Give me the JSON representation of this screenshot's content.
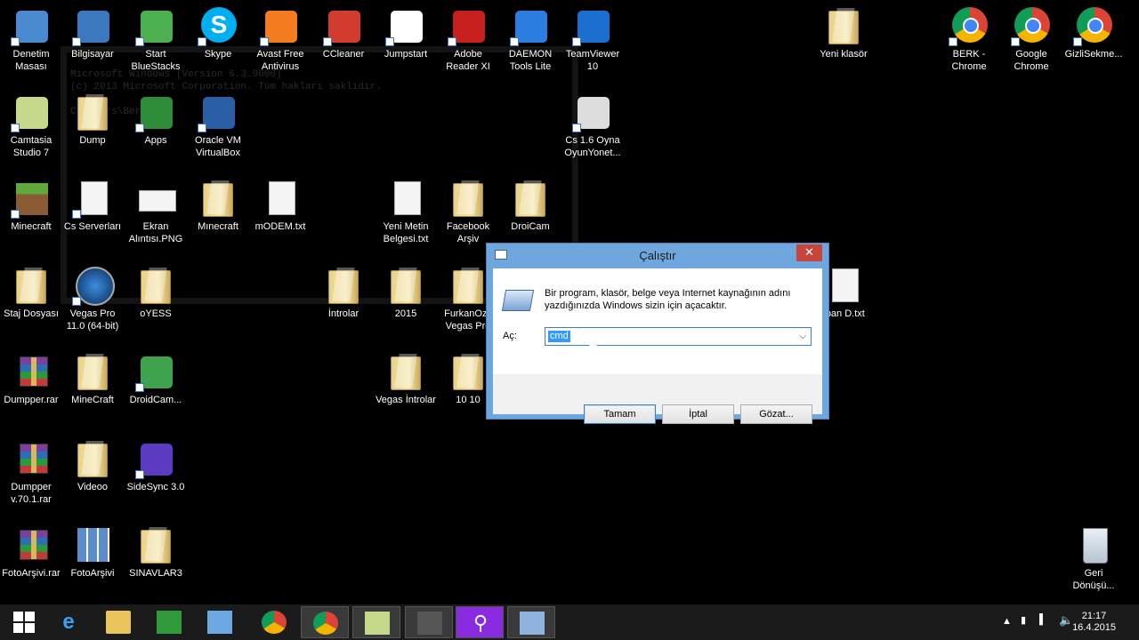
{
  "console": {
    "line1": "Microsoft Windows [Version 6.3.9600]",
    "line2": "(c) 2013 Microsoft Corporation. Tüm hakları saklıdır.",
    "line3": "C:\\Users\\Berk>"
  },
  "desktop_icons": [
    {
      "label": "Denetim Masası",
      "icon": "control-panel-icon"
    },
    {
      "label": "Bilgisayar",
      "icon": "computer-icon"
    },
    {
      "label": "Start BlueStacks",
      "icon": "bluestacks-icon"
    },
    {
      "label": "Skype",
      "icon": "skype-icon"
    },
    {
      "label": "Avast Free Antivirus",
      "icon": "avast-icon"
    },
    {
      "label": "CCleaner",
      "icon": "ccleaner-icon"
    },
    {
      "label": "Jumpstart",
      "icon": "jumpstart-icon"
    },
    {
      "label": "Adobe Reader XI",
      "icon": "adobe-reader-icon"
    },
    {
      "label": "DAEMON Tools Lite",
      "icon": "daemon-tools-icon"
    },
    {
      "label": "TeamViewer 10",
      "icon": "teamviewer-icon"
    },
    {
      "label": "Yeni klasör",
      "icon": "folder-icon"
    },
    {
      "label": "BERK - Chrome",
      "icon": "chrome-icon"
    },
    {
      "label": "Google Chrome",
      "icon": "chrome-icon"
    },
    {
      "label": "GizliSekme...",
      "icon": "chrome-icon"
    },
    {
      "label": "Camtasia Studio 7",
      "icon": "camtasia-icon"
    },
    {
      "label": "Dump",
      "icon": "folder-icon"
    },
    {
      "label": "Apps",
      "icon": "apps-icon"
    },
    {
      "label": "Oracle VM VirtualBox",
      "icon": "virtualbox-icon"
    },
    {
      "label": "Cs 1.6 Oyna OyunYonet...",
      "icon": "counter-strike-icon"
    },
    {
      "label": "Minecraft",
      "icon": "minecraft-icon"
    },
    {
      "label": "Cs Serverları",
      "icon": "document-icon"
    },
    {
      "label": "Ekran Alıntısı.PNG",
      "icon": "image-icon"
    },
    {
      "label": "Mınecraft",
      "icon": "folder-icon"
    },
    {
      "label": "mODEM.txt",
      "icon": "text-file-icon"
    },
    {
      "label": "Yeni Metin Belgesi.txt",
      "icon": "text-file-icon"
    },
    {
      "label": "Facebook Arşiv",
      "icon": "folder-icon"
    },
    {
      "label": "DroiCam",
      "icon": "folder-icon"
    },
    {
      "label": "Staj Dosyası",
      "icon": "folder-icon"
    },
    {
      "label": "Vegas Pro 11.0 (64-bit)",
      "icon": "vegas-pro-icon"
    },
    {
      "label": "oYESS",
      "icon": "folder-icon"
    },
    {
      "label": "İntrolar",
      "icon": "folder-icon"
    },
    {
      "label": "2015",
      "icon": "folder-icon"
    },
    {
      "label": "FurkanOzk Vegas Pro",
      "icon": "folder-icon"
    },
    {
      "label": "rban D.txt",
      "icon": "text-file-icon"
    },
    {
      "label": "Dumpper.rar",
      "icon": "winrar-icon"
    },
    {
      "label": "MineCraft",
      "icon": "folder-icon"
    },
    {
      "label": "DroidCam...",
      "icon": "droidcam-icon"
    },
    {
      "label": "Vegas İntrolar",
      "icon": "folder-icon"
    },
    {
      "label": "10 10",
      "icon": "folder-icon"
    },
    {
      "label": "Dumpper v.70.1.rar",
      "icon": "winrar-icon"
    },
    {
      "label": "Videoo",
      "icon": "folder-icon"
    },
    {
      "label": "SideSync 3.0",
      "icon": "sidesync-icon"
    },
    {
      "label": "FotoArşivi.rar",
      "icon": "winrar-icon"
    },
    {
      "label": "FotoArşivi",
      "icon": "photo-folder-icon"
    },
    {
      "label": "SINAVLAR3",
      "icon": "folder-icon"
    },
    {
      "label": "Geri Dönüşü...",
      "icon": "recycle-bin-icon"
    }
  ],
  "run_dialog": {
    "title": "Çalıştır",
    "close_glyph": "✕",
    "message": "Bir program, klasör, belge veya Internet kaynağının adını yazdığınızda Windows sizin için açacaktır.",
    "open_label": "Aç:",
    "input_value": "cmd",
    "ok_label": "Tamam",
    "cancel_label": "İptal",
    "browse_label": "Gözat..."
  },
  "taskbar": {
    "items": [
      "start",
      "internet-explorer",
      "file-explorer",
      "store",
      "control-panel",
      "chrome",
      "chrome-active",
      "camtasia",
      "counter-strike",
      "search-app",
      "run"
    ],
    "time": "21:17",
    "date": "16.4.2015"
  },
  "colors": {
    "dialog_frame": "#6fa6dd",
    "close_button": "#c7463b",
    "selection": "#3399ff",
    "taskbar": "#1b1b1b"
  }
}
